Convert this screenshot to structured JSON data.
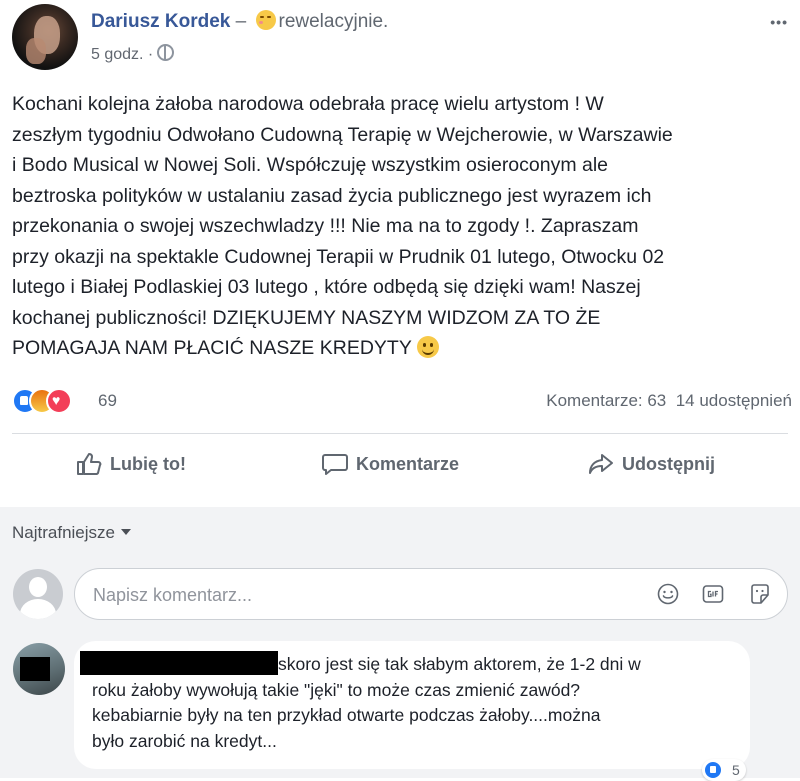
{
  "post": {
    "author": "Dariusz Kordek",
    "separator": " – ",
    "feeling": "rewelacyjnie.",
    "time": "5 godz. ·",
    "more": "•••",
    "text_lines": [
      "Kochani kolejna żałoba narodowa odebrała pracę wielu artystom ! W",
      "zeszłym tygodniu Odwołano Cudowną Terapię w Wejcherowie, w Warszawie",
      "i Bodo Musical w Nowej Soli. Współczuję wszystkim osieroconym ale",
      "beztroska polityków w ustalaniu zasad życia publicznego jest wyrazem ich",
      "przekonania o swojej wszechwladzy !!! Nie ma na to zgody !. Zapraszam",
      "przy okazji na spektakle Cudownej Terapii w Prudnik 01 lutego, Otwocku 02",
      "lutego i Białej Podlaskiej 03 lutego , które odbędą się dzięki wam! Naszej",
      "kochanej publiczności! DZIĘKUJEMY NASZYM WIDZOM ZA TO ŻE",
      "POMAGAJA NAM PŁACIĆ NASZE KREDYTY"
    ],
    "reactions_count": "69",
    "comments_count": "Komentarze: 63",
    "shares_count": "14 udostępnień",
    "actions": {
      "like": "Lubię to!",
      "comment": "Komentarze",
      "share": "Udostępnij"
    },
    "icons": [
      "globe-icon",
      "like-reaction-icon",
      "angry-reaction-icon",
      "love-reaction-icon",
      "thumbs-up-icon",
      "speech-bubble-icon",
      "share-arrow-icon"
    ]
  },
  "comments": {
    "sort_label": "Najtrafniejsze",
    "input_placeholder": "Napisz komentarz...",
    "input_icons": [
      "emoji-icon",
      "gif-icon",
      "sticker-icon"
    ],
    "items": [
      {
        "text_lines": [
          "skoro jest się tak słabym aktorem, że 1-2 dni w",
          "roku żałoby wywołują takie \"jęki\" to może czas zmienić zawód?",
          "kebabiarnie były na ten przykład otwarte podczas żałoby....można",
          "było zarobić na kredyt..."
        ],
        "reactions": "5"
      }
    ]
  },
  "colors": {
    "link": "#385898",
    "muted": "#606770",
    "like_blue": "#2078f4",
    "comments_bg": "#f2f3f5"
  }
}
